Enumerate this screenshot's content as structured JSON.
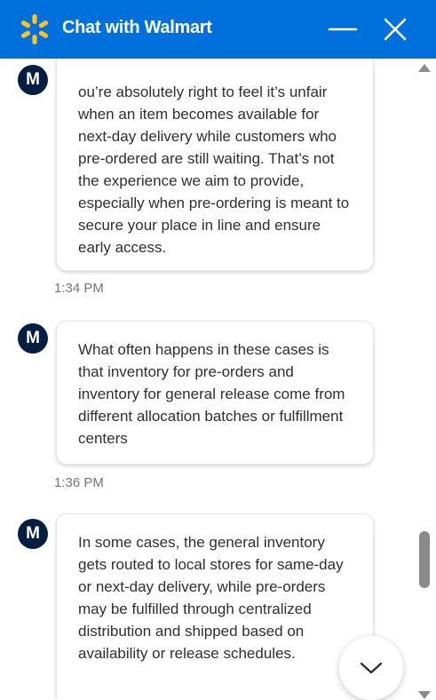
{
  "header": {
    "title": "Chat with Walmart",
    "brand_color": "#0071dc",
    "spark_color": "#ffc220",
    "logo_icon": "walmart-spark-icon",
    "minimize_icon": "minimize-icon",
    "close_icon": "close-icon"
  },
  "messages": [
    {
      "avatar": "M",
      "text": "ou’re absolutely right to feel it’s unfair when an item becomes available for next-day delivery while customers who pre-ordered are still waiting. That’s not the experience we aim to provide, especially when pre-ordering is meant to secure your place in line and ensure early access.",
      "time": "1:34 PM"
    },
    {
      "avatar": "M",
      "text": "What often happens in these cases is that inventory for pre-orders and inventory for general release come from different allocation batches or fulfillment centers",
      "time": "1:36 PM"
    },
    {
      "avatar": "M",
      "text": "In some cases, the general inventory gets routed to local stores for same-day or next-day delivery, while pre-orders may be fulfilled through centralized distribution and shipped based on availability or release schedules."
    }
  ],
  "jump_to_latest_icon": "chevron-down-icon"
}
